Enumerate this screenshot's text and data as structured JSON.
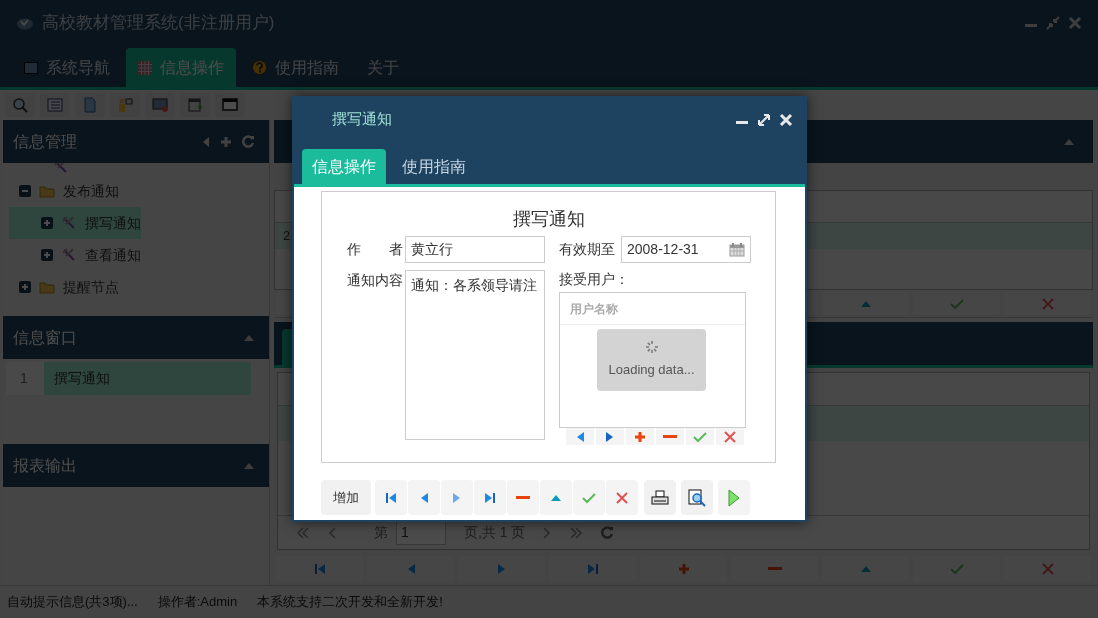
{
  "app": {
    "title": "高校教材管理系统(非注册用户)"
  },
  "nav_tabs": [
    {
      "label": "系统导航",
      "kind": "window",
      "selected": false
    },
    {
      "label": "信息操作",
      "kind": "grid",
      "selected": true
    },
    {
      "label": "使用指南",
      "kind": "help",
      "selected": false
    },
    {
      "label": "关于",
      "selected": false
    }
  ],
  "sidebar": {
    "info_management": {
      "title": "信息管理",
      "tree": [
        {
          "label": "发布通知",
          "kind": "folder",
          "expanded": true,
          "selected": false,
          "children": [
            {
              "label": "撰写通知",
              "kind": "leaf",
              "expanded": false,
              "selected": true
            },
            {
              "label": "查看通知",
              "kind": "leaf",
              "expanded": false,
              "selected": false
            }
          ]
        },
        {
          "label": "提醒节点",
          "kind": "folder",
          "expanded": false,
          "selected": false
        }
      ]
    },
    "info_window": {
      "title": "信息窗口",
      "rows": [
        {
          "index": "1",
          "label": "撰写通知",
          "selected": true
        }
      ]
    },
    "report_output": {
      "title": "报表输出"
    }
  },
  "background_grid": {
    "row_cell": "2",
    "pager": {
      "page_prefix": "第",
      "page_value": "1",
      "page_suffix": "页,共 1 页"
    }
  },
  "status_bar": [
    "自动提示信息(共3项)...",
    "操作者:Admin",
    "本系统支持二次开发和全新开发!"
  ],
  "dialog": {
    "title": "撰写通知",
    "tabs": [
      {
        "label": "信息操作",
        "selected": true
      },
      {
        "label": "使用指南",
        "selected": false
      }
    ],
    "form": {
      "heading": "撰写通知",
      "author_label": "作者",
      "author_value": "黄立行",
      "expiry_label": "有效期至",
      "expiry_value": "2008-12-31",
      "content_label": "通知内容",
      "content_value": "通知：各系领导请注",
      "recipients_label": "接受用户：",
      "recipients_column": "用户名称",
      "loading_text": "Loading data..."
    },
    "add_button": "增加"
  }
}
